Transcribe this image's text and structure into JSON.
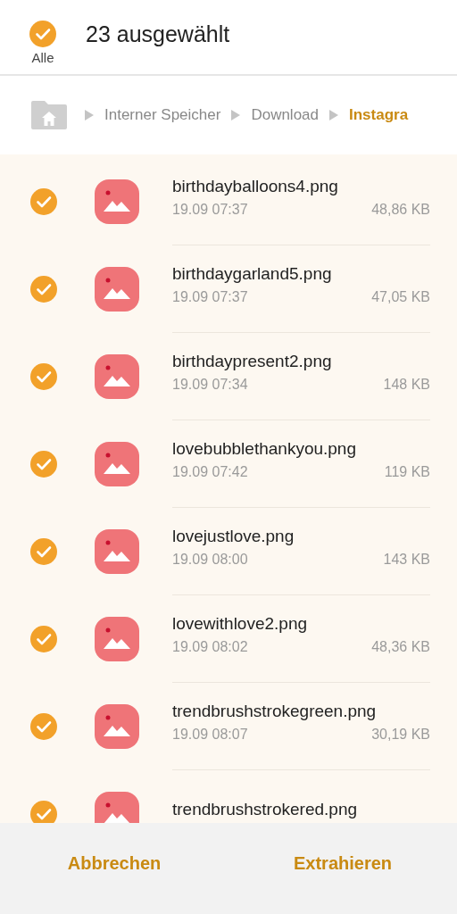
{
  "header": {
    "select_all": {
      "label": "Alle",
      "checked": true
    },
    "title": "23 ausgewählt"
  },
  "breadcrumb": [
    {
      "label": "Interner Speicher",
      "selected": false
    },
    {
      "label": "Download",
      "selected": false
    },
    {
      "label": "Instagra",
      "selected": true
    }
  ],
  "files": [
    {
      "name": "birthdayballoons4.png",
      "date": "19.09 07:37",
      "size": "48,86 KB",
      "checked": true
    },
    {
      "name": "birthdaygarland5.png",
      "date": "19.09 07:37",
      "size": "47,05 KB",
      "checked": true
    },
    {
      "name": "birthdaypresent2.png",
      "date": "19.09 07:34",
      "size": "148 KB",
      "checked": true
    },
    {
      "name": "lovebubblethankyou.png",
      "date": "19.09 07:42",
      "size": "119 KB",
      "checked": true
    },
    {
      "name": "lovejustlove.png",
      "date": "19.09 08:00",
      "size": "143 KB",
      "checked": true
    },
    {
      "name": "lovewithlove2.png",
      "date": "19.09 08:02",
      "size": "48,36 KB",
      "checked": true
    },
    {
      "name": "trendbrushstrokegreen.png",
      "date": "19.09 08:07",
      "size": "30,19 KB",
      "checked": true
    },
    {
      "name": "trendbrushstrokered.png",
      "checked": true
    }
  ],
  "buttons": [
    "Abbrechen",
    "Extrahieren"
  ]
}
